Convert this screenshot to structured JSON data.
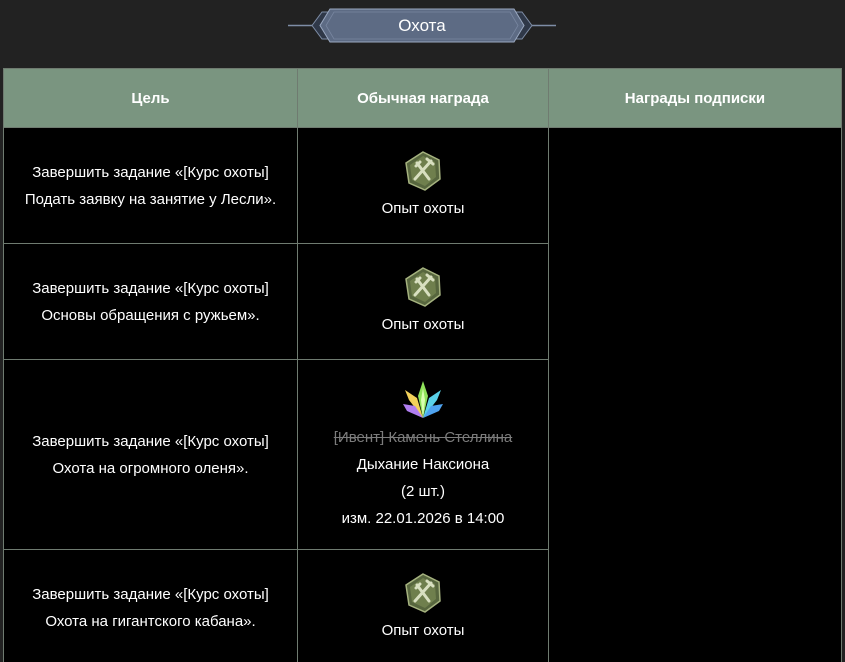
{
  "banner": {
    "title": "Охота"
  },
  "table": {
    "headers": {
      "goal": "Цель",
      "normal_reward": "Обычная награда",
      "subscription_reward": "Награды подписки"
    },
    "rows": [
      {
        "goal": "Завершить задание «[Курс охоты] Подать заявку на занятие у Лесли».",
        "reward_icon": "hunting-exp-icon",
        "reward_label": "Опыт охоты"
      },
      {
        "goal": "Завершить задание «[Курс охоты] Основы обращения с ружьем».",
        "reward_icon": "hunting-exp-icon",
        "reward_label": "Опыт охоты"
      },
      {
        "goal": "Завершить задание «[Курс охоты] Охота на огромного оленя».",
        "reward_icon": "stellin-stone-icon",
        "reward_old_label": "[Ивент] Камень Стеллина",
        "reward_label": "Дыхание Наксиона",
        "reward_qty": "(2 шт.)",
        "reward_changed": "изм. 22.01.2026 в 14:00"
      },
      {
        "goal": "Завершить задание «[Курс охоты] Охота на гигантского кабана».",
        "reward_icon": "hunting-exp-icon",
        "reward_label": "Опыт охоты"
      }
    ]
  },
  "colors": {
    "header_bg": "#7a9580",
    "cell_bg": "#000000",
    "page_bg": "#222222",
    "banner_fill": "#5d6b84",
    "strike_text": "#7c7c7c"
  }
}
